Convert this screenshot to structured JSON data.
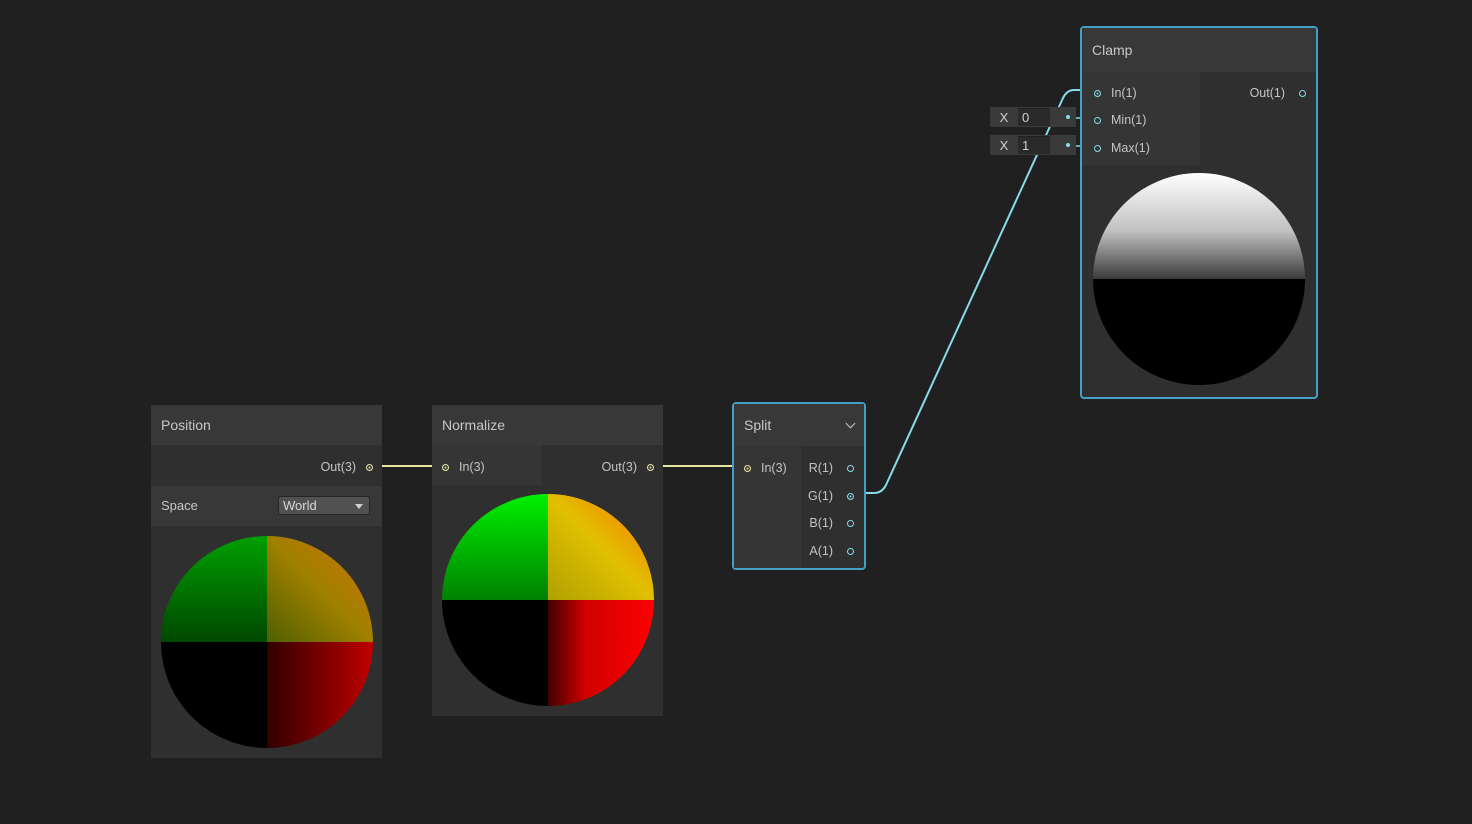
{
  "colors": {
    "background": "#202020",
    "vector_wire": "#e6e6a0",
    "float_wire": "#86dce6",
    "selection": "#45a0c8"
  },
  "nodes": {
    "position": {
      "title": "Position",
      "out_label": "Out(3)",
      "space_label": "Space",
      "space_value": "World"
    },
    "normalize": {
      "title": "Normalize",
      "in_label": "In(3)",
      "out_label": "Out(3)"
    },
    "split": {
      "title": "Split",
      "in_label": "In(3)",
      "outputs": [
        "R(1)",
        "G(1)",
        "B(1)",
        "A(1)"
      ]
    },
    "clamp": {
      "title": "Clamp",
      "inputs": [
        "In(1)",
        "Min(1)",
        "Max(1)"
      ],
      "out_label": "Out(1)",
      "min_field": {
        "axis": "X",
        "value": "0"
      },
      "max_field": {
        "axis": "X",
        "value": "1"
      }
    }
  }
}
